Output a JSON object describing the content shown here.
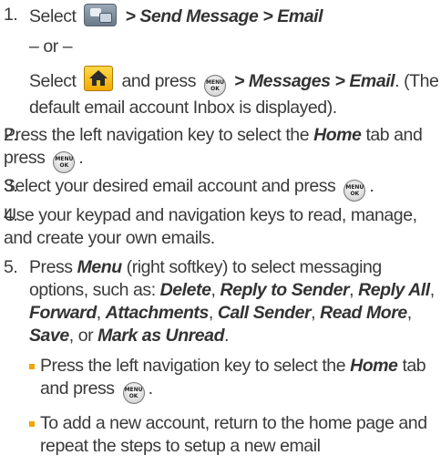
{
  "steps": [
    {
      "num": "1.",
      "l1_prefix": "Select",
      "l1_menu": "> Send Message > Email",
      "or": "– or –",
      "l2_a": "Select",
      "l2_b": "and press",
      "l2_menu": "> Messages > Email",
      "l2_c": ". (The default email account Inbox is displayed)."
    },
    {
      "num": "2.",
      "text_a": "Press the left navigation key to select the",
      "text_em": "Home",
      "text_b": "tab and press",
      "text_c": "."
    },
    {
      "num": "3.",
      "text_a": "Select your desired email account and press",
      "text_c": "."
    },
    {
      "num": "4.",
      "text_a": "Use your keypad and navigation keys to read, manage, and create your own emails."
    },
    {
      "num": "5.",
      "text_a": "Press",
      "menu": "Menu",
      "text_b": "(right softkey) to select messaging options, such as:",
      "options": [
        "Delete",
        "Reply to Sender",
        "Reply All",
        "Forward",
        "Attachments",
        "Call Sender",
        "Read More",
        "Save"
      ],
      "or": "or",
      "last_option": "Mark as Unread",
      "bullets": [
        {
          "a": "Press the left navigation key to select the",
          "em": "Home",
          "b": "tab and press",
          "c": "."
        },
        {
          "a": "To add a new account, return to the home page and repeat the steps to setup a new email"
        }
      ]
    }
  ],
  "icons": {
    "messaging": "messaging-icon",
    "home": "home-icon",
    "menu_ok": "menu-ok-key-icon",
    "menu_key_top": "MENU",
    "menu_key_bottom": "OK"
  },
  "colors": {
    "bullet": "#f0a500",
    "home_icon": "#f2a900",
    "text": "#3a3a3a"
  }
}
